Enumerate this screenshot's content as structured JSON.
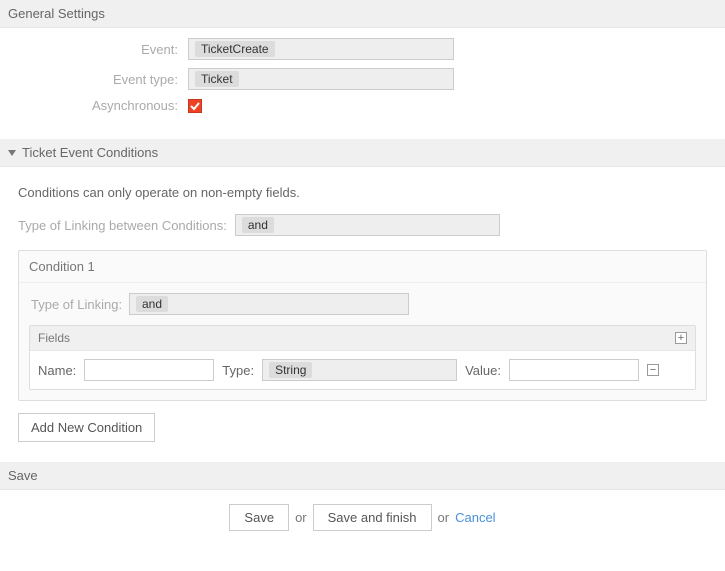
{
  "sections": {
    "general": {
      "title": "General Settings"
    },
    "conditions": {
      "title": "Ticket Event Conditions"
    },
    "save": {
      "title": "Save"
    }
  },
  "general": {
    "event_label": "Event:",
    "event_value": "TicketCreate",
    "event_type_label": "Event type:",
    "event_type_value": "Ticket",
    "async_label": "Asynchronous:",
    "async_checked": true
  },
  "conditions": {
    "help_text": "Conditions can only operate on non-empty fields.",
    "linking_label": "Type of Linking between Conditions:",
    "linking_value": "and",
    "condition1": {
      "title": "Condition 1",
      "type_of_linking_label": "Type of Linking:",
      "type_of_linking_value": "and",
      "fields_header": "Fields",
      "name_label": "Name:",
      "name_value": "",
      "type_label": "Type:",
      "type_value": "String",
      "value_label": "Value:",
      "value_value": ""
    },
    "add_condition_label": "Add New Condition"
  },
  "footer": {
    "save_label": "Save",
    "or": "or",
    "save_finish_label": "Save and finish",
    "cancel_label": "Cancel"
  }
}
